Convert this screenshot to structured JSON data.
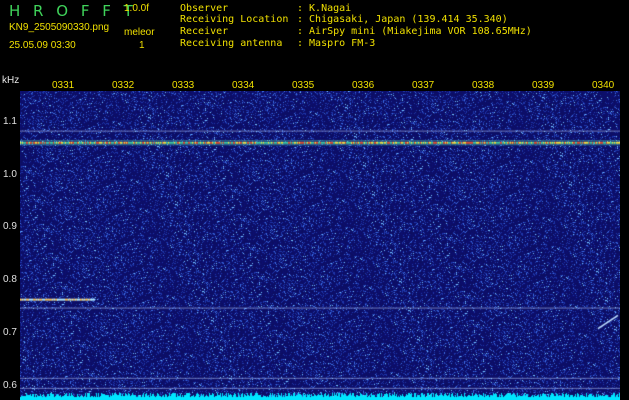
{
  "header": {
    "app_title": "H R O F F T",
    "version": "1.0.0f",
    "filename": "KN9_2505090330.png",
    "meleor_label": "meleor",
    "meleor_count": "1",
    "datetime": "25.05.09 03:30"
  },
  "info": [
    {
      "key": "Observer",
      "value": ": K.Nagai"
    },
    {
      "key": "Receiving Location",
      "value": ": Chigasaki, Japan (139.414 35.340)"
    },
    {
      "key": "Receiver",
      "value": ": AirSpy mini (Miakejima VOR 108.65MHz)"
    },
    {
      "key": "Receiving antenna",
      "value": ": Maspro FM-3"
    }
  ],
  "chart_data": {
    "type": "heatmap",
    "ylabel": "kHz",
    "x_ticks": [
      "0331",
      "0332",
      "0333",
      "0334",
      "0335",
      "0336",
      "0337",
      "0338",
      "0339",
      "0340"
    ],
    "y_ticks": [
      "1.1",
      "1.0",
      "0.9",
      "0.8",
      "0.7",
      "0.6"
    ],
    "ylim": [
      0.575,
      1.16
    ],
    "features": [
      {
        "kind": "carrier",
        "y": 1.062
      },
      {
        "kind": "meteor_trail",
        "y": 0.765,
        "x_from": "0331",
        "x_to": "0332"
      },
      {
        "kind": "line",
        "y": 1.085
      },
      {
        "kind": "line",
        "y": 0.75
      },
      {
        "kind": "line",
        "y": 0.617
      },
      {
        "kind": "line",
        "y": 0.598
      }
    ],
    "colors": {
      "background": "#0b0b60",
      "noise_low": "#1a2ca8",
      "noise_high": "#4fb8ff",
      "carrier": "#e05030",
      "floor": "#00e5ff"
    }
  }
}
